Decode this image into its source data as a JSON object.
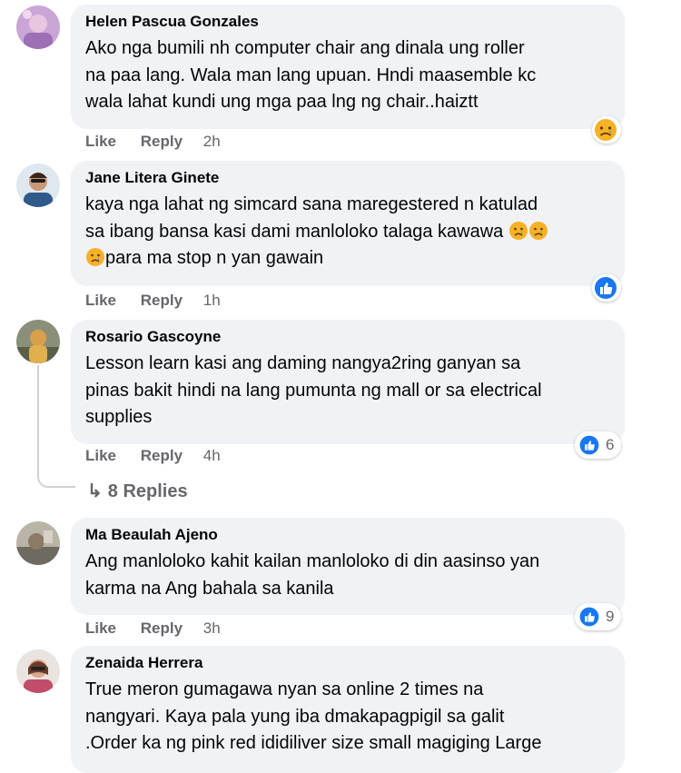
{
  "comments": [
    {
      "author": "Helen Pascua Gonzales",
      "text": "Ako nga bumili nh computer chair ang dinala ung roller\nna paa lang. Wala man lang upuan. Hndi maasemble kc\nwala lahat kundi ung mga paa lng ng chair..haiztt",
      "like_label": "Like",
      "reply_label": "Reply",
      "time": "2h",
      "reaction": "sad"
    },
    {
      "author": "Jane Litera Ginete",
      "text_line1": "kaya nga lahat ng simcard sana maregestered n katulad",
      "text_line2": "sa ibang bansa kasi dami manloloko talaga kawawa",
      "text_line3": "para ma stop n yan gawain",
      "like_label": "Like",
      "reply_label": "Reply",
      "time": "1h",
      "reaction": "like"
    },
    {
      "author": "Rosario Gascoyne",
      "text": "Lesson learn kasi ang daming nangya2ring ganyan sa\npinas bakit hindi na lang pumunta ng mall or sa electrical\nsupplies",
      "like_label": "Like",
      "reply_label": "Reply",
      "time": "4h",
      "reaction": "like",
      "reaction_count": "6",
      "replies_label": "8 Replies"
    },
    {
      "author": "Ma Beaulah Ajeno",
      "text": "Ang manloloko kahit kailan manloloko di din aasinso yan\nkarma na Ang bahala sa kanila",
      "like_label": "Like",
      "reply_label": "Reply",
      "time": "3h",
      "reaction": "like",
      "reaction_count": "9"
    },
    {
      "author": "Zenaida Herrera",
      "text": "True meron gumagawa nyan sa online 2 times na\nnangyari. Kaya pala yung iba dmakapagpigil sa galit\n.Order ka ng pink red ididiliver size small magiging Large"
    }
  ],
  "colors": {
    "bubble": "#f0f2f5",
    "like_blue": "#1877f2",
    "muted": "#65676b"
  }
}
